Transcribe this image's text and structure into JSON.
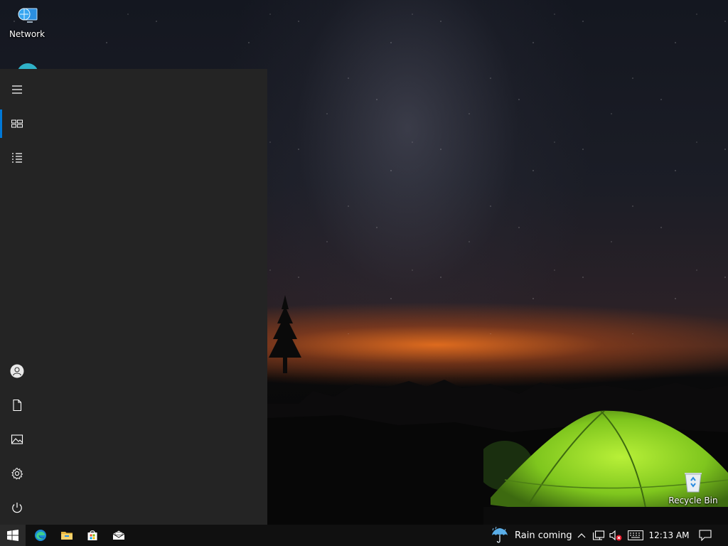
{
  "desktop": {
    "icons": [
      {
        "label": "Network",
        "icon": "network-icon"
      },
      {
        "label": "Recycle Bin",
        "icon": "recycle-bin-icon"
      }
    ]
  },
  "start_menu": {
    "rail": [
      {
        "icon": "hamburger-menu-icon",
        "label": "Expand"
      },
      {
        "icon": "pinned-tiles-icon",
        "label": "Pinned tiles",
        "active": true
      },
      {
        "icon": "all-apps-list-icon",
        "label": "All apps"
      },
      {
        "icon": "user-account-icon",
        "label": "Account"
      },
      {
        "icon": "documents-icon",
        "label": "Documents"
      },
      {
        "icon": "pictures-icon",
        "label": "Pictures"
      },
      {
        "icon": "settings-gear-icon",
        "label": "Settings"
      },
      {
        "icon": "power-icon",
        "label": "Power"
      }
    ]
  },
  "taskbar": {
    "pinned": [
      "windows-start-icon",
      "edge-browser-icon",
      "file-explorer-icon",
      "microsoft-store-icon",
      "mail-icon"
    ],
    "weather": {
      "icon": "rain-umbrella-icon",
      "text": "Rain coming"
    },
    "tray": [
      "show-hidden-icons-chevron",
      "network-icon",
      "volume-muted-icon",
      "touch-keyboard-icon"
    ],
    "clock": "12:13 AM",
    "notification_icon": "action-center-icon"
  },
  "colors": {
    "accent": "#0078d7",
    "start_menu_bg": "#242424",
    "taskbar_bg": "#101010",
    "tent_green": "#8fd12a"
  }
}
